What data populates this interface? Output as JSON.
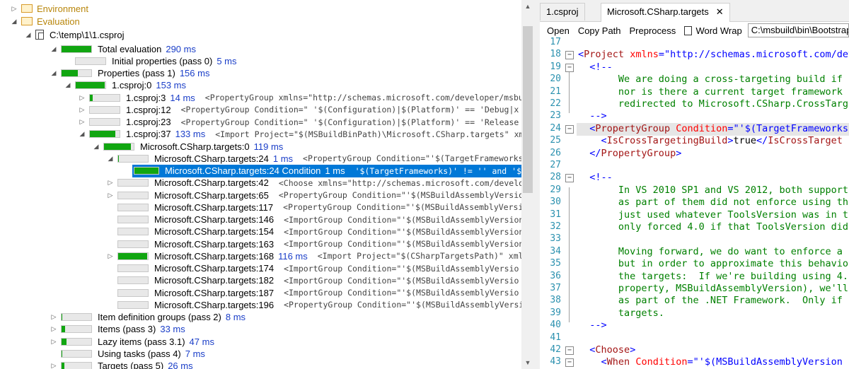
{
  "tree": {
    "environment": "Environment",
    "evaluation": "Evaluation",
    "project_path": "C:\\temp\\1\\1.csproj",
    "rows": [
      {
        "indent": 70,
        "exp": "◢",
        "pct": 1.0,
        "label": "Total evaluation",
        "dur": "290 ms",
        "xml": ""
      },
      {
        "indent": 90,
        "exp": "",
        "pct": 0.0,
        "label": "Initial properties (pass 0)",
        "dur": "5 ms",
        "xml": ""
      },
      {
        "indent": 70,
        "exp": "◢",
        "pct": 0.54,
        "label": "Properties (pass 1)",
        "dur": "156 ms",
        "xml": ""
      },
      {
        "indent": 90,
        "exp": "◢",
        "pct": 0.98,
        "label": "1.csproj:0",
        "dur": "153 ms",
        "xml": ""
      },
      {
        "indent": 110,
        "exp": "▷",
        "pct": 0.1,
        "label": "1.csproj:3",
        "dur": "14 ms",
        "xml": "<PropertyGroup xmlns=\"http://schemas.microsoft.com/developer/msbu"
      },
      {
        "indent": 110,
        "exp": "▷",
        "pct": 0.0,
        "label": "1.csproj:12",
        "dur": "",
        "xml": "<PropertyGroup Condition=\" '$(Configuration)|$(Platform)' == 'Debug|x"
      },
      {
        "indent": 110,
        "exp": "▷",
        "pct": 0.0,
        "label": "1.csproj:23",
        "dur": "",
        "xml": "<PropertyGroup Condition=\" '$(Configuration)|$(Platform)' == 'Release"
      },
      {
        "indent": 110,
        "exp": "◢",
        "pct": 0.86,
        "label": "1.csproj:37",
        "dur": "133 ms",
        "xml": "<Import Project=\"$(MSBuildBinPath)\\Microsoft.CSharp.targets\" xm"
      },
      {
        "indent": 130,
        "exp": "◢",
        "pct": 0.9,
        "label": "Microsoft.CSharp.targets:0",
        "dur": "119 ms",
        "xml": ""
      },
      {
        "indent": 150,
        "exp": "◢",
        "pct": 0.01,
        "label": "Microsoft.CSharp.targets:24",
        "dur": "1 ms",
        "xml": "<PropertyGroup Condition=\"'$(TargetFrameworks)'"
      },
      {
        "indent": 170,
        "exp": "",
        "pct": 1.0,
        "label": "Microsoft.CSharp.targets:24 Condition",
        "dur": "1 ms",
        "xml": "'$(TargetFrameworks)' != '' and '$",
        "selected": true
      },
      {
        "indent": 150,
        "exp": "▷",
        "pct": 0.0,
        "label": "Microsoft.CSharp.targets:42",
        "dur": "",
        "xml": "<Choose xmlns=\"http://schemas.microsoft.com/develo"
      },
      {
        "indent": 150,
        "exp": "▷",
        "pct": 0.0,
        "label": "Microsoft.CSharp.targets:65",
        "dur": "",
        "xml": "<PropertyGroup Condition=\"'$(MSBuildAssemblyVersio"
      },
      {
        "indent": 150,
        "exp": "",
        "pct": 0.0,
        "label": "Microsoft.CSharp.targets:117",
        "dur": "",
        "xml": "<PropertyGroup Condition=\"'$(MSBuildAssemblyVersi"
      },
      {
        "indent": 150,
        "exp": "",
        "pct": 0.0,
        "label": "Microsoft.CSharp.targets:146",
        "dur": "",
        "xml": "<ImportGroup Condition=\"'$(MSBuildAssemblyVersion"
      },
      {
        "indent": 150,
        "exp": "",
        "pct": 0.0,
        "label": "Microsoft.CSharp.targets:154",
        "dur": "",
        "xml": "<ImportGroup Condition=\"'$(MSBuildAssemblyVersion"
      },
      {
        "indent": 150,
        "exp": "",
        "pct": 0.0,
        "label": "Microsoft.CSharp.targets:163",
        "dur": "",
        "xml": "<ImportGroup Condition=\"'$(MSBuildAssemblyVersion"
      },
      {
        "indent": 150,
        "exp": "▷",
        "pct": 0.97,
        "label": "Microsoft.CSharp.targets:168",
        "dur": "116 ms",
        "xml": "<Import Project=\"$(CSharpTargetsPath)\" xmlns"
      },
      {
        "indent": 150,
        "exp": "",
        "pct": 0.0,
        "label": "Microsoft.CSharp.targets:174",
        "dur": "",
        "xml": "<ImportGroup Condition=\"'$(MSBuildAssemblyVersio"
      },
      {
        "indent": 150,
        "exp": "",
        "pct": 0.0,
        "label": "Microsoft.CSharp.targets:182",
        "dur": "",
        "xml": "<ImportGroup Condition=\"'$(MSBuildAssemblyVersio"
      },
      {
        "indent": 150,
        "exp": "",
        "pct": 0.0,
        "label": "Microsoft.CSharp.targets:187",
        "dur": "",
        "xml": "<ImportGroup Condition=\"'$(MSBuildAssemblyVersio"
      },
      {
        "indent": 150,
        "exp": "",
        "pct": 0.0,
        "label": "Microsoft.CSharp.targets:196",
        "dur": "",
        "xml": "<PropertyGroup Condition=\"'$(MSBuildAssemblyVersio"
      },
      {
        "indent": 70,
        "exp": "▷",
        "pct": 0.03,
        "label": "Item definition groups (pass 2)",
        "dur": "8 ms",
        "xml": ""
      },
      {
        "indent": 70,
        "exp": "▷",
        "pct": 0.11,
        "label": "Items (pass 3)",
        "dur": "33 ms",
        "xml": ""
      },
      {
        "indent": 70,
        "exp": "▷",
        "pct": 0.16,
        "label": "Lazy items (pass 3.1)",
        "dur": "47 ms",
        "xml": ""
      },
      {
        "indent": 70,
        "exp": "",
        "pct": 0.02,
        "label": "Using tasks (pass 4)",
        "dur": "7 ms",
        "xml": ""
      },
      {
        "indent": 70,
        "exp": "▷",
        "pct": 0.09,
        "label": "Targets (pass 5)",
        "dur": "26 ms",
        "xml": ""
      }
    ]
  },
  "tabs": [
    {
      "label": "1.csproj",
      "active": false
    },
    {
      "label": "Microsoft.CSharp.targets",
      "active": true
    }
  ],
  "toolbar": {
    "open": "Open",
    "copy_path": "Copy Path",
    "preprocess": "Preprocess",
    "word_wrap": "Word Wrap",
    "path": "C:\\msbuild\\bin\\Bootstrap\\"
  },
  "editor": {
    "lines": [
      {
        "n": "17",
        "html": ""
      },
      {
        "n": "18",
        "html": "<span class='t-b'>&lt;</span><span class='t-tag'>Project</span> <span class='t-attr'>xmlns</span><span class='t-b'>=\"http://schemas.microsoft.com/dev</span>"
      },
      {
        "n": "19",
        "html": "  <span class='t-b'>&lt;!--</span>"
      },
      {
        "n": "20",
        "html": "<span class='t-cmt'>       We are doing a cross-targeting build if</span>"
      },
      {
        "n": "21",
        "html": "<span class='t-cmt'>       nor is there a current target framework</span>"
      },
      {
        "n": "22",
        "html": "<span class='t-cmt'>       redirected to Microsoft.CSharp.CrossTarg</span>"
      },
      {
        "n": "23",
        "html": "  <span class='t-b'>--&gt;</span>"
      },
      {
        "n": "24",
        "html": "  <span class='t-b'>&lt;</span><span class='t-tag'>PropertyGroup</span> <span class='t-attr'>Condition</span><span class='t-b'>=\"'$(TargetFrameworks</span>"
      },
      {
        "n": "25",
        "html": "    <span class='t-b'>&lt;</span><span class='t-tag'>IsCrossTargetingBuild</span><span class='t-b'>&gt;</span><span class='t-txt'>true</span><span class='t-b'>&lt;/</span><span class='t-tag'>IsCrossTarget</span>"
      },
      {
        "n": "26",
        "html": "  <span class='t-b'>&lt;/</span><span class='t-tag'>PropertyGroup</span><span class='t-b'>&gt;</span>"
      },
      {
        "n": "27",
        "html": ""
      },
      {
        "n": "28",
        "html": "  <span class='t-b'>&lt;!--</span>"
      },
      {
        "n": "29",
        "html": "<span class='t-cmt'>       In VS 2010 SP1 and VS 2012, both support</span>"
      },
      {
        "n": "30",
        "html": "<span class='t-cmt'>       as part of them did not enforce using th</span>"
      },
      {
        "n": "31",
        "html": "<span class='t-cmt'>       just used whatever ToolsVersion was in t</span>"
      },
      {
        "n": "32",
        "html": "<span class='t-cmt'>       only forced 4.0 if that ToolsVersion did</span>"
      },
      {
        "n": "33",
        "html": ""
      },
      {
        "n": "34",
        "html": "<span class='t-cmt'>       Moving forward, we do want to enforce a</span>"
      },
      {
        "n": "35",
        "html": "<span class='t-cmt'>       but in order to approximate this behavio</span>"
      },
      {
        "n": "36",
        "html": "<span class='t-cmt'>       the targets:  If we're building using 4.</span>"
      },
      {
        "n": "37",
        "html": "<span class='t-cmt'>       property, MSBuildAssemblyVersion), we'll</span>"
      },
      {
        "n": "38",
        "html": "<span class='t-cmt'>       as part of the .NET Framework.  Only if</span>"
      },
      {
        "n": "39",
        "html": "<span class='t-cmt'>       targets.</span>"
      },
      {
        "n": "40",
        "html": "  <span class='t-b'>--&gt;</span>"
      },
      {
        "n": "41",
        "html": ""
      },
      {
        "n": "42",
        "html": "  <span class='t-b'>&lt;</span><span class='t-tag'>Choose</span><span class='t-b'>&gt;</span>"
      },
      {
        "n": "43",
        "html": "    <span class='t-b'>&lt;</span><span class='t-tag'>When</span> <span class='t-attr'>Condition</span><span class='t-b'>=\"'$(MSBuildAssemblyVersion</span>"
      }
    ]
  },
  "colors": {
    "bar_fill": "#11a611",
    "duration": "#1a3ec8",
    "selection": "#0078d7",
    "line_numbers": "#2b91af"
  }
}
